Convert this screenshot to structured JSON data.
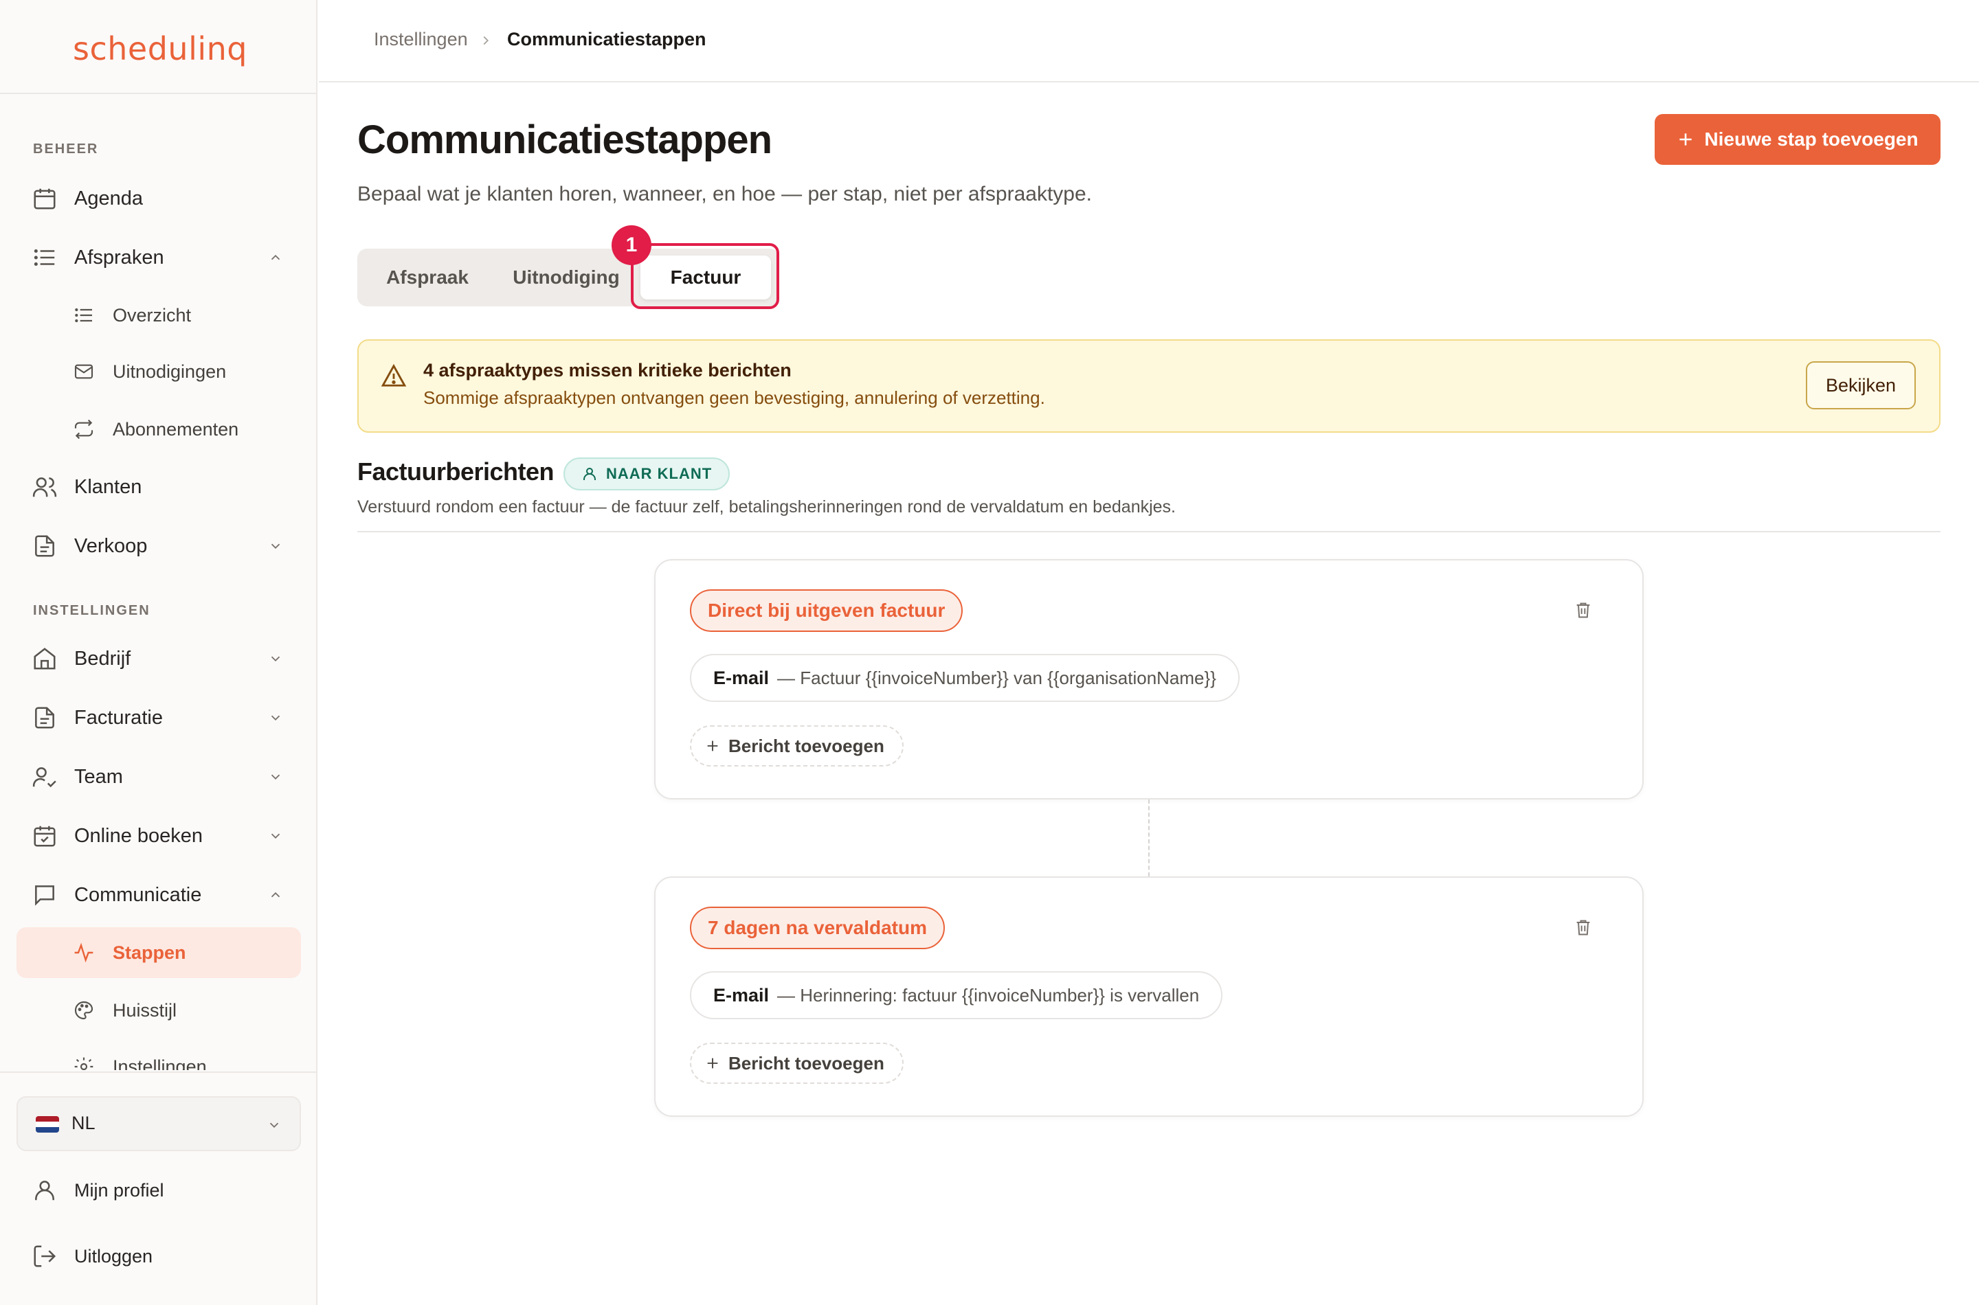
{
  "brand": {
    "logo_text": "schedulinq",
    "accent": "#ea6239"
  },
  "sidebar": {
    "section_beheer": "BEHEER",
    "section_instellingen": "INSTELLINGEN",
    "agenda": "Agenda",
    "afspraken": "Afspraken",
    "overzicht": "Overzicht",
    "uitnodigingen": "Uitnodigingen",
    "abonnementen": "Abonnementen",
    "klanten": "Klanten",
    "verkoop": "Verkoop",
    "bedrijf": "Bedrijf",
    "facturatie": "Facturatie",
    "team": "Team",
    "online_boeken": "Online boeken",
    "communicatie": "Communicatie",
    "stappen": "Stappen",
    "huisstijl": "Huisstijl",
    "instellingen": "Instellingen",
    "language": "NL",
    "profile": "Mijn profiel",
    "logout": "Uitloggen"
  },
  "breadcrumb": {
    "parent": "Instellingen",
    "current": "Communicatiestappen"
  },
  "page": {
    "title": "Communicatiestappen",
    "subtitle": "Bepaal wat je klanten horen, wanneer, en hoe — per stap, niet per afspraaktype.",
    "new_step_button": "Nieuwe stap toevoegen"
  },
  "tabs": {
    "afspraak": "Afspraak",
    "uitnodiging": "Uitnodiging",
    "factuur": "Factuur",
    "active": "Factuur",
    "annotation_badge": "1"
  },
  "alert": {
    "title": "4 afspraaktypes missen kritieke berichten",
    "message": "Sommige afspraaktypen ontvangen geen bevestiging, annulering of verzetting.",
    "button": "Bekijken"
  },
  "section": {
    "title": "Factuurberichten",
    "badge": "NAAR KLANT",
    "description": "Verstuurd rondom een factuur — de factuur zelf, betalingsherinneringen rond de vervaldatum en bedankjes."
  },
  "steps": [
    {
      "trigger": "Direct bij uitgeven factuur",
      "message_kind": "E-mail",
      "message_subject": "— Factuur {{invoiceNumber}} van {{organisationName}}",
      "add_label": "Bericht toevoegen"
    },
    {
      "trigger": "7 dagen na vervaldatum",
      "message_kind": "E-mail",
      "message_subject": "— Herinnering: factuur {{invoiceNumber}} is vervallen",
      "add_label": "Bericht toevoegen"
    }
  ]
}
